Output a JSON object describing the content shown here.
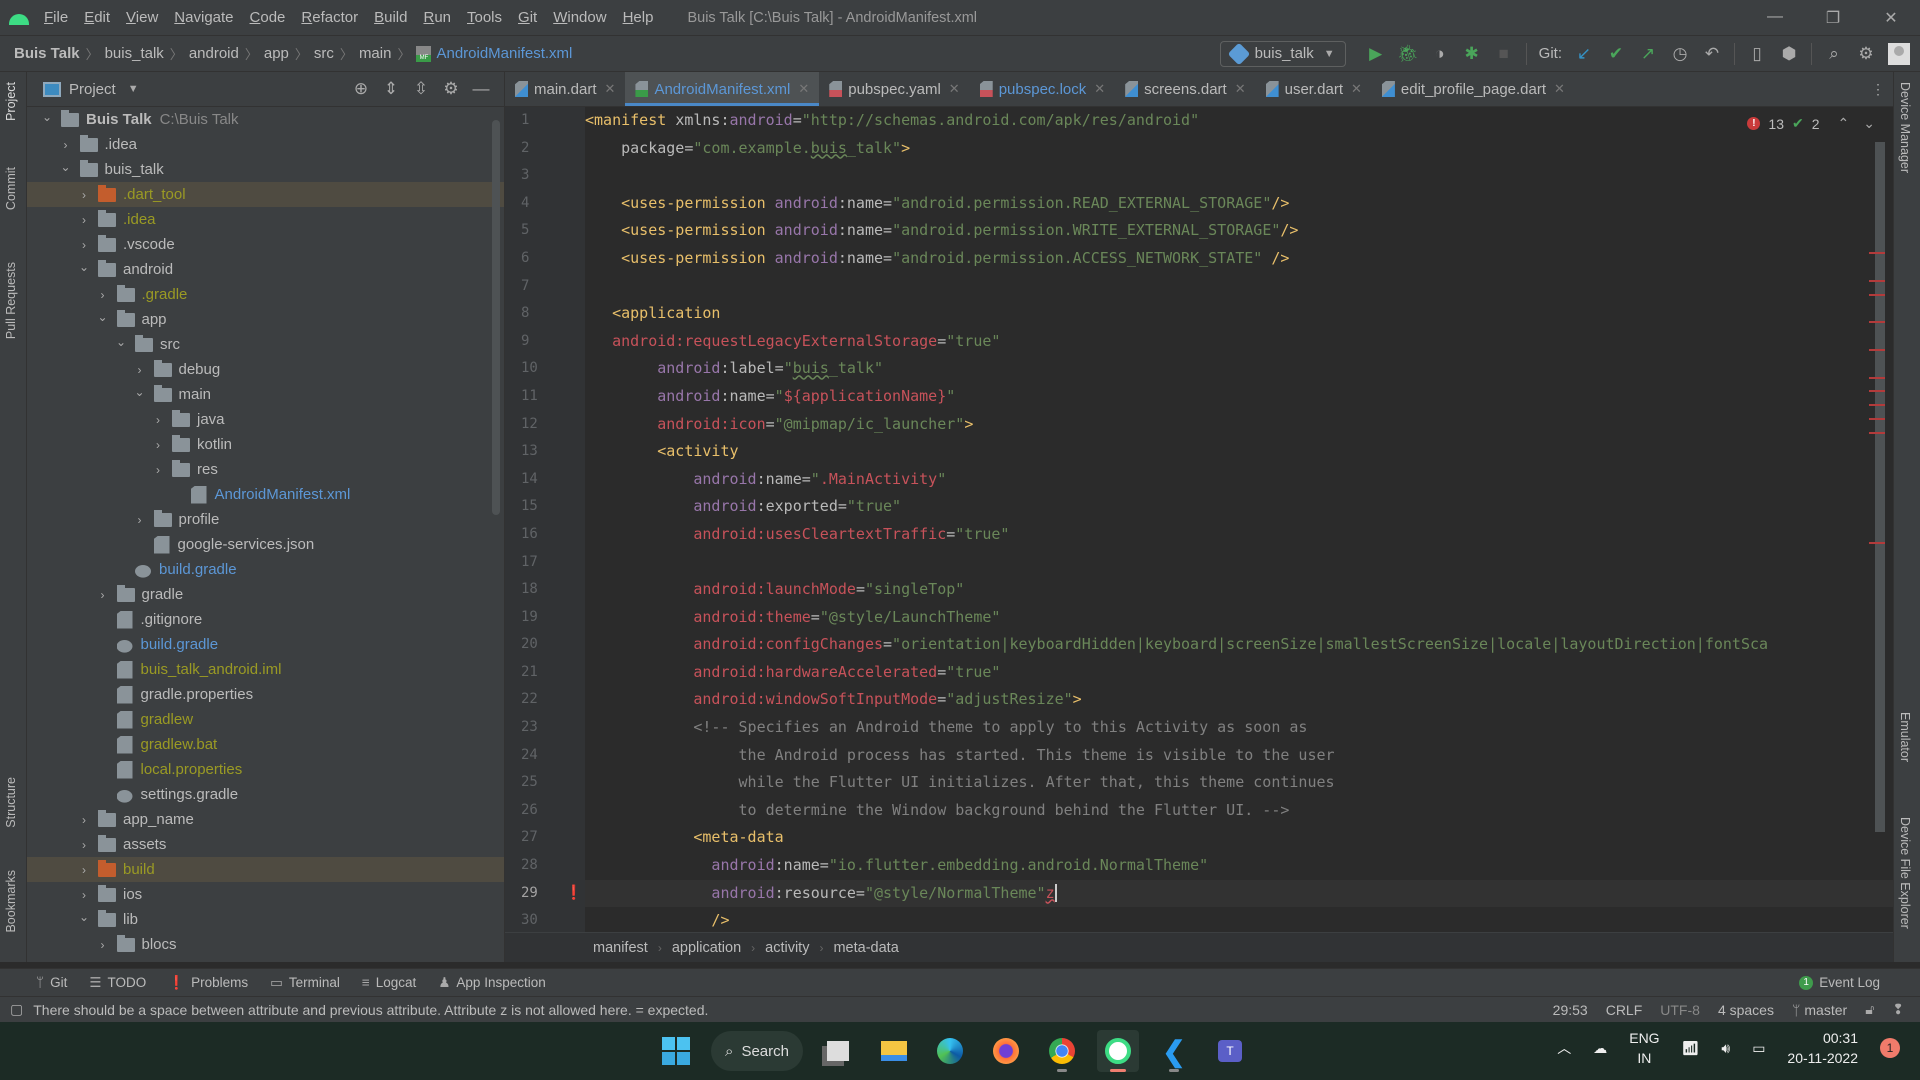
{
  "titlebar": {
    "menus": [
      "File",
      "Edit",
      "View",
      "Navigate",
      "Code",
      "Refactor",
      "Build",
      "Run",
      "Tools",
      "Git",
      "Window",
      "Help"
    ],
    "window_title": "Buis Talk [C:\\Buis Talk] - AndroidManifest.xml"
  },
  "navbar": {
    "crumbs": [
      "Buis Talk",
      "buis_talk",
      "android",
      "app",
      "src",
      "main"
    ],
    "file": "AndroidManifest.xml",
    "run_config": "buis_talk",
    "git_label": "Git:"
  },
  "left_stripe": [
    "Project",
    "Commit",
    "Pull Requests",
    "Structure",
    "Bookmarks"
  ],
  "right_stripe": [
    "Device Manager",
    "Emulator",
    "Device File Explorer"
  ],
  "project": {
    "title": "Project",
    "tree": [
      {
        "label": "Buis Talk",
        "extra": "C:\\Buis Talk",
        "depth": 0,
        "type": "root",
        "open": true
      },
      {
        "label": ".idea",
        "depth": 1,
        "type": "folder",
        "open": false
      },
      {
        "label": "buis_talk",
        "depth": 1,
        "type": "folder",
        "open": true
      },
      {
        "label": ".dart_tool",
        "depth": 2,
        "type": "folder-orange",
        "open": false,
        "color": "yellow",
        "hl": true
      },
      {
        "label": ".idea",
        "depth": 2,
        "type": "folder",
        "open": false,
        "color": "yellow"
      },
      {
        "label": ".vscode",
        "depth": 2,
        "type": "folder",
        "open": false
      },
      {
        "label": "android",
        "depth": 2,
        "type": "folder",
        "open": true
      },
      {
        "label": ".gradle",
        "depth": 3,
        "type": "folder",
        "open": false,
        "color": "yellow"
      },
      {
        "label": "app",
        "depth": 3,
        "type": "folder",
        "open": true
      },
      {
        "label": "src",
        "depth": 4,
        "type": "folder",
        "open": true
      },
      {
        "label": "debug",
        "depth": 5,
        "type": "folder",
        "open": false
      },
      {
        "label": "main",
        "depth": 5,
        "type": "folder",
        "open": true
      },
      {
        "label": "java",
        "depth": 6,
        "type": "folder",
        "open": false
      },
      {
        "label": "kotlin",
        "depth": 6,
        "type": "folder",
        "open": false
      },
      {
        "label": "res",
        "depth": 6,
        "type": "folder",
        "open": false
      },
      {
        "label": "AndroidManifest.xml",
        "depth": 7,
        "type": "file",
        "color": "blue"
      },
      {
        "label": "profile",
        "depth": 5,
        "type": "folder",
        "open": false
      },
      {
        "label": "google-services.json",
        "depth": 5,
        "type": "file",
        "leaf": true
      },
      {
        "label": "build.gradle",
        "depth": 4,
        "type": "gradle",
        "color": "blue",
        "leaf": true
      },
      {
        "label": "gradle",
        "depth": 3,
        "type": "folder",
        "open": false
      },
      {
        "label": ".gitignore",
        "depth": 3,
        "type": "file",
        "leaf": true
      },
      {
        "label": "build.gradle",
        "depth": 3,
        "type": "gradle",
        "color": "blue",
        "leaf": true
      },
      {
        "label": "buis_talk_android.iml",
        "depth": 3,
        "type": "file",
        "color": "yellow",
        "leaf": true
      },
      {
        "label": "gradle.properties",
        "depth": 3,
        "type": "file",
        "leaf": true
      },
      {
        "label": "gradlew",
        "depth": 3,
        "type": "file",
        "color": "yellow",
        "leaf": true
      },
      {
        "label": "gradlew.bat",
        "depth": 3,
        "type": "file",
        "color": "yellow",
        "leaf": true
      },
      {
        "label": "local.properties",
        "depth": 3,
        "type": "file",
        "color": "yellow",
        "leaf": true
      },
      {
        "label": "settings.gradle",
        "depth": 3,
        "type": "gradle",
        "leaf": true
      },
      {
        "label": "app_name",
        "depth": 2,
        "type": "folder",
        "open": false
      },
      {
        "label": "assets",
        "depth": 2,
        "type": "folder",
        "open": false
      },
      {
        "label": "build",
        "depth": 2,
        "type": "folder-orange",
        "open": false,
        "color": "yellow",
        "hl": true
      },
      {
        "label": "ios",
        "depth": 2,
        "type": "folder",
        "open": false
      },
      {
        "label": "lib",
        "depth": 2,
        "type": "folder",
        "open": true
      },
      {
        "label": "blocs",
        "depth": 3,
        "type": "folder",
        "open": false
      }
    ]
  },
  "tabs": [
    {
      "label": "main.dart",
      "icon": "dart"
    },
    {
      "label": "AndroidManifest.xml",
      "icon": "mf",
      "active": true
    },
    {
      "label": "pubspec.yaml",
      "icon": "yml"
    },
    {
      "label": "pubspec.lock",
      "icon": "yml",
      "color": "blue"
    },
    {
      "label": "screens.dart",
      "icon": "dart"
    },
    {
      "label": "user.dart",
      "icon": "dart"
    },
    {
      "label": "edit_profile_page.dart",
      "icon": "dart"
    }
  ],
  "inspections": {
    "errors": "13",
    "warnings": "2"
  },
  "code": [
    [
      [
        "tag",
        "<manifest "
      ],
      [
        "attr",
        "xmlns:"
      ],
      [
        "ns",
        "android"
      ],
      [
        "attr",
        "="
      ],
      [
        "str",
        "\"http://schemas.android.com/apk/res/android\""
      ]
    ],
    [
      [
        "attr",
        "    package"
      ],
      [
        "attr",
        "="
      ],
      [
        "str",
        "\"com.example."
      ],
      [
        "sq",
        "buis"
      ],
      [
        "str",
        "_talk\""
      ],
      [
        "tag",
        ">"
      ]
    ],
    [],
    [
      [
        "tag",
        "    <uses-permission "
      ],
      [
        "ns",
        "android"
      ],
      [
        "attr",
        ":name="
      ],
      [
        "str",
        "\"android.permission.READ_EXTERNAL_STORAGE\""
      ],
      [
        "tag",
        "/>"
      ]
    ],
    [
      [
        "tag",
        "    <uses-permission "
      ],
      [
        "ns",
        "android"
      ],
      [
        "attr",
        ":name="
      ],
      [
        "str",
        "\"android.permission.WRITE_EXTERNAL_STORAGE\""
      ],
      [
        "tag",
        "/>"
      ]
    ],
    [
      [
        "tag",
        "    <uses-permission "
      ],
      [
        "ns",
        "android"
      ],
      [
        "attr",
        ":name="
      ],
      [
        "str",
        "\"android.permission.ACCESS_NETWORK_STATE\""
      ],
      [
        "tag",
        " />"
      ]
    ],
    [],
    [
      [
        "tag",
        "   <application"
      ]
    ],
    [
      [
        "err",
        "   android:requestLegacyExternalStorage"
      ],
      [
        "attr",
        "="
      ],
      [
        "str",
        "\"true\""
      ]
    ],
    [
      [
        "ns",
        "        android"
      ],
      [
        "attr",
        ":label="
      ],
      [
        "str",
        "\""
      ],
      [
        "sq",
        "buis"
      ],
      [
        "str",
        "_talk\""
      ]
    ],
    [
      [
        "ns",
        "        android"
      ],
      [
        "attr",
        ":name="
      ],
      [
        "str",
        "\""
      ],
      [
        "err",
        "${applicationName}"
      ],
      [
        "str",
        "\""
      ]
    ],
    [
      [
        "err",
        "        android:icon"
      ],
      [
        "attr",
        "="
      ],
      [
        "str",
        "\"@mipmap/ic_launcher\""
      ],
      [
        "tag",
        ">"
      ]
    ],
    [
      [
        "tag",
        "        <activity"
      ]
    ],
    [
      [
        "ns",
        "            android"
      ],
      [
        "attr",
        ":name="
      ],
      [
        "str",
        "\""
      ],
      [
        "err",
        ".MainActivity"
      ],
      [
        "str",
        "\""
      ]
    ],
    [
      [
        "ns",
        "            android"
      ],
      [
        "attr",
        ":exported="
      ],
      [
        "str",
        "\"true\""
      ]
    ],
    [
      [
        "err",
        "            android:usesCleartextTraffic"
      ],
      [
        "attr",
        "="
      ],
      [
        "str",
        "\"true\""
      ]
    ],
    [],
    [
      [
        "err",
        "            android:launchMode"
      ],
      [
        "attr",
        "="
      ],
      [
        "str",
        "\"singleTop\""
      ]
    ],
    [
      [
        "err",
        "            android:theme"
      ],
      [
        "attr",
        "="
      ],
      [
        "str",
        "\"@style/LaunchTheme\""
      ]
    ],
    [
      [
        "err",
        "            android:configChanges"
      ],
      [
        "attr",
        "="
      ],
      [
        "str",
        "\"orientation|keyboardHidden|keyboard|screenSize|smallestScreenSize|locale|layoutDirection|fontSca"
      ]
    ],
    [
      [
        "err",
        "            android:hardwareAccelerated"
      ],
      [
        "attr",
        "="
      ],
      [
        "str",
        "\"true\""
      ]
    ],
    [
      [
        "err",
        "            android:windowSoftInputMode"
      ],
      [
        "attr",
        "="
      ],
      [
        "str",
        "\"adjustResize\""
      ],
      [
        "tag",
        ">"
      ]
    ],
    [
      [
        "cmt",
        "            <!-- Specifies an Android theme to apply to this Activity as soon as"
      ]
    ],
    [
      [
        "cmt",
        "                 the Android process has started. This theme is visible to the user"
      ]
    ],
    [
      [
        "cmt",
        "                 while the Flutter UI initializes. After that, this theme continues"
      ]
    ],
    [
      [
        "cmt",
        "                 to determine the Window background behind the Flutter UI. -->"
      ]
    ],
    [
      [
        "tag",
        "            <meta-data"
      ]
    ],
    [
      [
        "ns",
        "              android"
      ],
      [
        "attr",
        ":name="
      ],
      [
        "str",
        "\"io.flutter.embedding.android.NormalTheme\""
      ]
    ],
    [
      [
        "ns",
        "              android"
      ],
      [
        "attr",
        ":resource="
      ],
      [
        "str",
        "\"@style/NormalTheme\""
      ],
      [
        "errsq",
        "z"
      ],
      [
        "caret",
        ""
      ]
    ],
    [
      [
        "tag",
        "              />"
      ]
    ]
  ],
  "current_line": 29,
  "breadcrumbs": [
    "manifest",
    "application",
    "activity",
    "meta-data"
  ],
  "tool_windows": [
    {
      "label": "Git",
      "icon": "ᛘ"
    },
    {
      "label": "TODO",
      "icon": "☰"
    },
    {
      "label": "Problems",
      "icon": "❗"
    },
    {
      "label": "Terminal",
      "icon": "▭"
    },
    {
      "label": "Logcat",
      "icon": "≡"
    },
    {
      "label": "App Inspection",
      "icon": "♟"
    }
  ],
  "event_log": {
    "count": "1",
    "label": "Event Log"
  },
  "status": {
    "message": "There should be a space between attribute and previous attribute. Attribute z is not allowed here. = expected.",
    "position": "29:53",
    "line_sep": "CRLF",
    "encoding": "UTF-8",
    "indent": "4 spaces",
    "branch": "master"
  },
  "taskbar": {
    "search": "Search",
    "lang1": "ENG",
    "lang2": "IN",
    "time": "00:31",
    "date": "20-11-2022",
    "notifications": "1"
  }
}
